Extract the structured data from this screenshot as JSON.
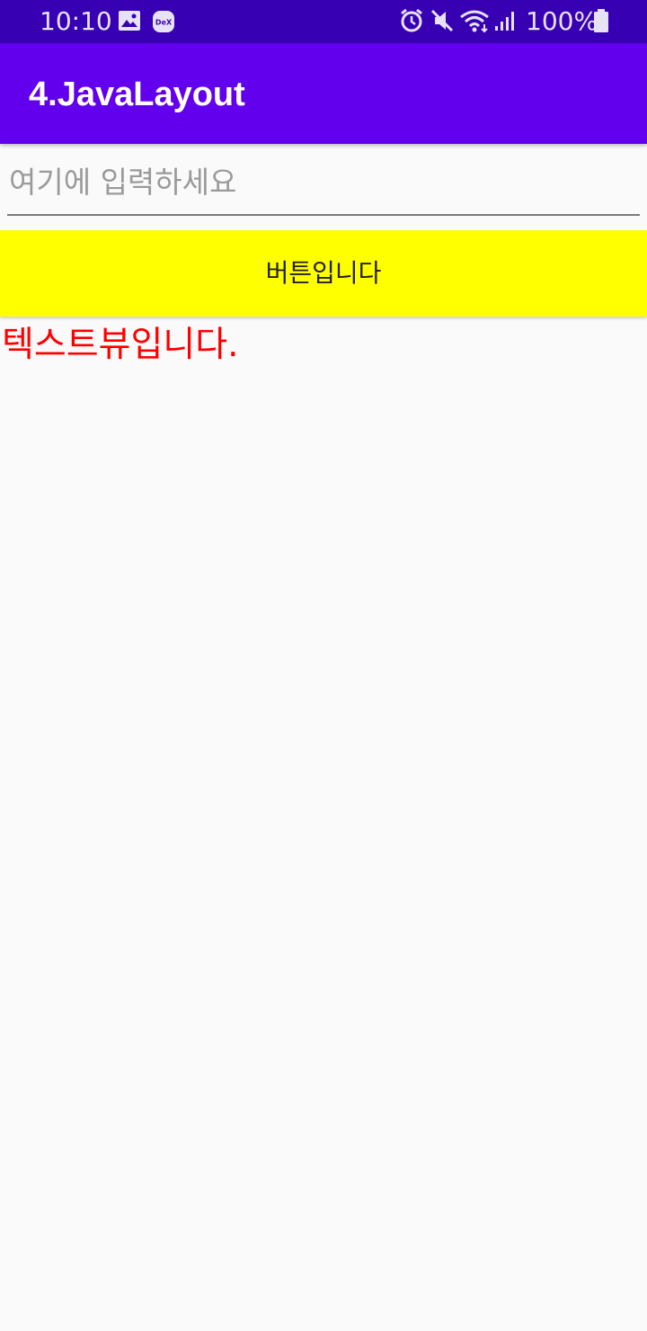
{
  "status_bar": {
    "time": "10:10",
    "battery_percent": "100%",
    "left_icons": [
      "image-icon",
      "dex-icon"
    ],
    "right_icons": [
      "alarm-icon",
      "mute-icon",
      "wifi-icon",
      "signal-icon",
      "battery-icon"
    ],
    "dex_label": "DeX",
    "background_color": "#3700b3"
  },
  "app_bar": {
    "title": "4.JavaLayout",
    "background_color": "#6200ee"
  },
  "main": {
    "input": {
      "value": "",
      "placeholder": "여기에 입력하세요"
    },
    "button": {
      "label": "버튼입니다",
      "background_color": "#ffff00"
    },
    "text_view": {
      "text": "텍스트뷰입니다.",
      "color": "#ff0000"
    }
  }
}
